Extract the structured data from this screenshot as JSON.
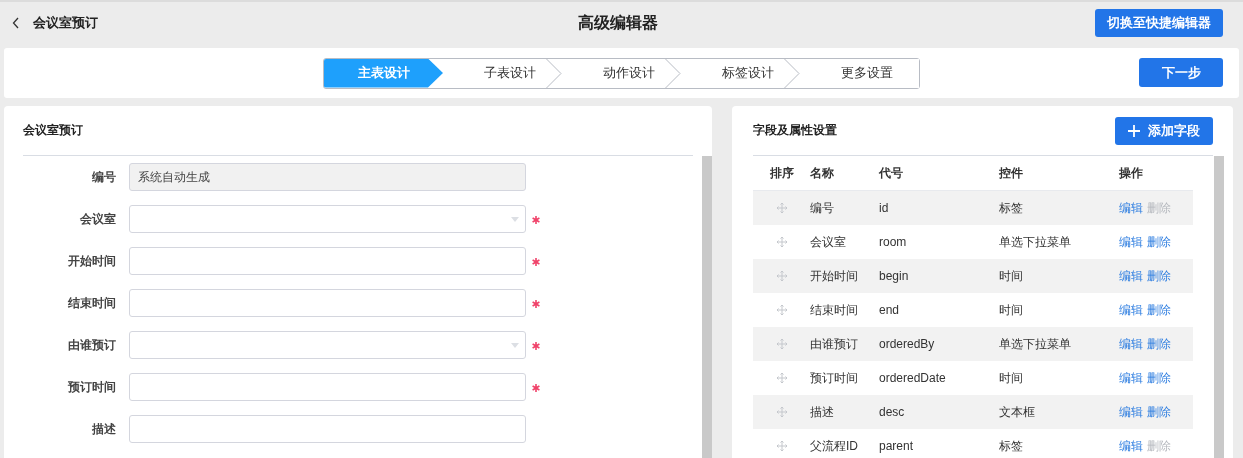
{
  "header": {
    "back_label": "会议室预订",
    "title": "高级编辑器",
    "switch_button": "切换至快捷编辑器"
  },
  "steps": [
    {
      "label": "主表设计",
      "selected": true
    },
    {
      "label": "子表设计",
      "selected": false
    },
    {
      "label": "动作设计",
      "selected": false
    },
    {
      "label": "标签设计",
      "selected": false
    },
    {
      "label": "更多设置",
      "selected": false
    }
  ],
  "next_button": "下一步",
  "form": {
    "title": "会议室预订",
    "fields": [
      {
        "label": "编号",
        "kind": "readonly",
        "value": "系统自动生成",
        "required": false
      },
      {
        "label": "会议室",
        "kind": "select",
        "required": true
      },
      {
        "label": "开始时间",
        "kind": "text",
        "required": true
      },
      {
        "label": "结束时间",
        "kind": "text",
        "required": true
      },
      {
        "label": "由谁预订",
        "kind": "select",
        "required": true
      },
      {
        "label": "预订时间",
        "kind": "text",
        "required": true
      },
      {
        "label": "描述",
        "kind": "text",
        "required": false
      }
    ]
  },
  "fields_panel": {
    "title": "字段及属性设置",
    "add_button": "添加字段",
    "columns": [
      "排序",
      "名称",
      "代号",
      "控件",
      "操作"
    ],
    "rows": [
      {
        "name": "编号",
        "code": "id",
        "control": "标签",
        "edit": "编辑",
        "delete": "删除",
        "deletable": false
      },
      {
        "name": "会议室",
        "code": "room",
        "control": "单选下拉菜单",
        "edit": "编辑",
        "delete": "删除",
        "deletable": true
      },
      {
        "name": "开始时间",
        "code": "begin",
        "control": "时间",
        "edit": "编辑",
        "delete": "删除",
        "deletable": true
      },
      {
        "name": "结束时间",
        "code": "end",
        "control": "时间",
        "edit": "编辑",
        "delete": "删除",
        "deletable": true
      },
      {
        "name": "由谁预订",
        "code": "orderedBy",
        "control": "单选下拉菜单",
        "edit": "编辑",
        "delete": "删除",
        "deletable": true
      },
      {
        "name": "预订时间",
        "code": "orderedDate",
        "control": "时间",
        "edit": "编辑",
        "delete": "删除",
        "deletable": true
      },
      {
        "name": "描述",
        "code": "desc",
        "control": "文本框",
        "edit": "编辑",
        "delete": "删除",
        "deletable": true
      },
      {
        "name": "父流程ID",
        "code": "parent",
        "control": "标签",
        "edit": "编辑",
        "delete": "删除",
        "deletable": false
      }
    ]
  }
}
